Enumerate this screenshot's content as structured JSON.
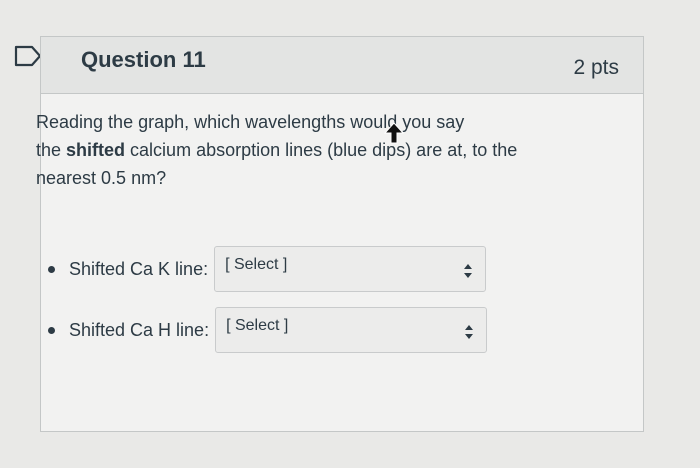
{
  "question": {
    "title": "Question 11",
    "points": "2 pts",
    "text_line1": "Reading the graph, which wavelengths would you say",
    "text_line2_pre": "the ",
    "text_line2_bold": "shifted",
    "text_line2_post": " calcium absorption lines (blue dips) are at, to the",
    "text_line3": "nearest 0.5 nm?"
  },
  "answers": [
    {
      "label": "Shifted Ca K line:",
      "select_value": "[ Select ]"
    },
    {
      "label": "Shifted Ca H line:",
      "select_value": "[ Select ]"
    }
  ],
  "icons": {
    "flag": "bookmark-flag-icon",
    "select_arrows": "up-down-chevron-icon",
    "cursor": "mouse-pointer-icon"
  },
  "colors": {
    "text": "#2d3b45",
    "header_bg": "#e3e4e3",
    "card_bg": "#f2f2f1",
    "border": "#c4c7c7"
  }
}
